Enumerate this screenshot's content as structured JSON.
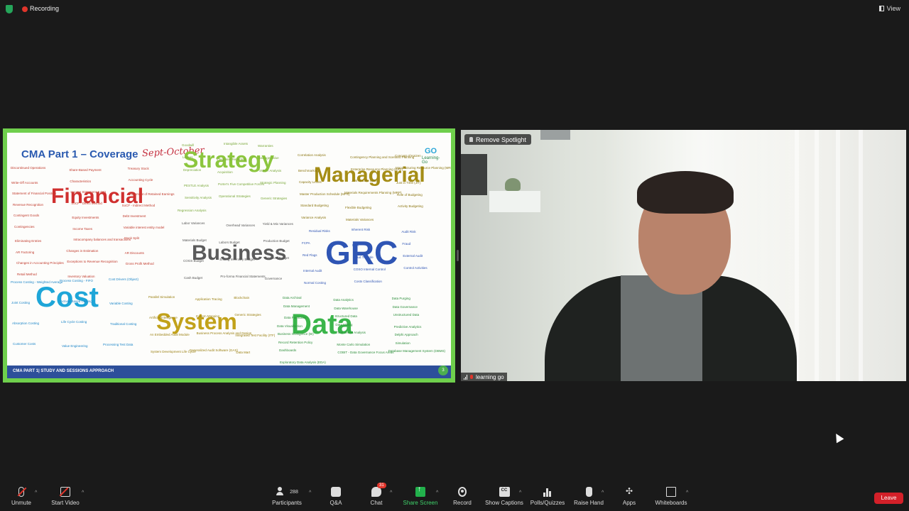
{
  "topbar": {
    "recording_label": "Recording",
    "view_label": "View"
  },
  "slide": {
    "title": "CMA Part 1 – Coverage",
    "annotation": "Sept-October",
    "logo_text": "Learning-Go",
    "footer": "CMA PART 1| STUDY AND SESSIONS APPROACH",
    "page_number": "3",
    "big_words": [
      {
        "text": "Financial",
        "color": "#d0302f"
      },
      {
        "text": "Strategy",
        "color": "#8cc63e"
      },
      {
        "text": "Managerial",
        "color": "#a58d16"
      },
      {
        "text": "Business",
        "color": "#5b5b5b"
      },
      {
        "text": "GRC",
        "color": "#2f55b4"
      },
      {
        "text": "Cost",
        "color": "#1ea6d8"
      },
      {
        "text": "System",
        "color": "#c2a21a"
      },
      {
        "text": "Data",
        "color": "#3ab54a"
      }
    ],
    "small_words": [
      "Discontinued Operations",
      "Share-Based Payment",
      "Treasury Stock",
      "Write-Off Accounts",
      "Characteristics",
      "Accounting Cycle",
      "Statement of Financial Position",
      "Income Statement & OCI",
      "Statement of Retained Earnings",
      "Revenue Recognition",
      "SoCF - Direct Method",
      "SoCF - Indirect Method",
      "Contingent Goods",
      "Equity Investments",
      "Debt Investment",
      "Contingencies",
      "Income Taxes",
      "Variable interest entity model",
      "Eliminating Entries",
      "Intracompany balances and transactions",
      "Stock Split",
      "AR Factoring",
      "Changes in Estimation",
      "AR Discounts",
      "Changes in Accounting Principles",
      "Exceptions to Revenue Recognition",
      "Gross Profit Method",
      "Retail Method",
      "Inventory Valuation",
      "Goodwill",
      "Intangible Assets",
      "Warranties",
      "Leases",
      "Integrated Reporting",
      "Salvage Value",
      "Depreciation",
      "Acquisition",
      "SWOT Analysis",
      "PESTLE Analysis",
      "Porter's Five Competitive Forces",
      "Strategic Planning",
      "Sensitivity Analysis",
      "Operational Strategies",
      "Generic Strategies",
      "Regression Analysis",
      "Correlation Analysis",
      "Contingency Planning and Scenario Planning",
      "Concept of Kaizen",
      "Benchmarking",
      "Enterprise Resource Planning (ERP)",
      "Manufacturing Resource Planning (MRP II)",
      "Capacity Levels",
      "Just in Case (JIC)",
      "Just in Time (JIT)",
      "Master Production Schedule (MPS)",
      "Materials Requirements Planning (MRP)",
      "Role of Budgeting",
      "Standard Budgeting",
      "Flexible Budgeting",
      "Activity Budgeting",
      "Variance Analysis",
      "Materials Variances",
      "Labor Variances",
      "Overhead Variances",
      "Yield & Mix Variances",
      "Materials Budget",
      "Labors Budget",
      "Production Budget",
      "COGS Budget",
      "Ending Inventory Budget",
      "Overhead Budget",
      "Cash Budget",
      "Pro-forma Financial Statements",
      "Governance",
      "Residual Risks",
      "Inherent Risk",
      "Audit Risk",
      "FCPA",
      "SOX",
      "Fraud",
      "Red Flags",
      "Fraud Triangle",
      "External Audit",
      "Internal Audit",
      "COSO Internal Control",
      "Control Activities",
      "Normal Costing",
      "Costs Classification",
      "Process Costing - Weighted Average",
      "Process Costing - FIFO",
      "Cost Drivers (Object)",
      "Joint Costing",
      "Activity Based Costing",
      "Variable Costing",
      "Absorption Costing",
      "Life Cycle Costing",
      "Traditional Costing",
      "Customer Costs",
      "Value Engineering",
      "Processing Test Data",
      "Parallel Simulation",
      "Application Tracing",
      "Blockchain",
      "Artificial Intelligence",
      "System Mapping",
      "Generic Strategies",
      "An Embedded Audit Module",
      "Business Process Analysis and Design",
      "Integrated Test Facility (ITF)",
      "System Development Life Cycle",
      "Generalized Audit Software (GAS)",
      "Data Mart",
      "Data Archival",
      "Data Analytics",
      "Data Purging",
      "Data Management",
      "Data Warehouse",
      "Data Governance",
      "Data Publication",
      "Structured Data",
      "Unstructured Data",
      "Data Visualization",
      "Data Mining",
      "Predictive Analytics",
      "Business Intelligence (BI)",
      "Time Series Analysis",
      "Delphi Approach",
      "Record Retention Policy",
      "Monte Carlo Simulation",
      "Simulation",
      "Dashboards",
      "COBIT - Data Governance Focus Areas",
      "Database Management System (DBMS)",
      "Exploratory Data Analysis (EDA)"
    ]
  },
  "video": {
    "spotlight_label": "Remove Spotlight",
    "participant_name": "learning go"
  },
  "toolbar": {
    "unmute": "Unmute",
    "start_video": "Start Video",
    "participants": "Participants",
    "participant_count": "288",
    "qa": "Q&A",
    "chat": "Chat",
    "chat_badge": "31",
    "share_screen": "Share Screen",
    "record": "Record",
    "show_captions": "Show Captions",
    "cc": "CC",
    "polls": "Polls/Quizzes",
    "raise_hand": "Raise Hand",
    "apps": "Apps",
    "whiteboards": "Whiteboards",
    "leave": "Leave"
  }
}
